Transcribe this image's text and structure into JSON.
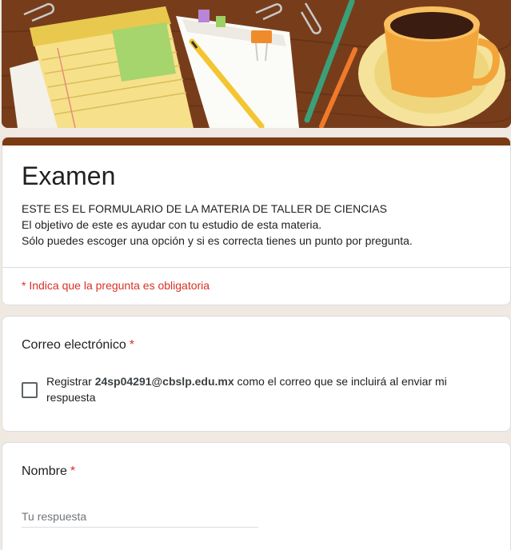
{
  "form": {
    "title": "Examen",
    "description": [
      "ESTE ES EL FORMULARIO DE LA MATERIA DE TALLER DE CIENCIAS",
      "El objetivo de este es ayudar con tu estudio de esta materia.",
      "Sólo puedes escoger una opción y si es correcta tienes un punto por pregunta."
    ],
    "required_note": "* Indica que la pregunta es obligatoria"
  },
  "email_question": {
    "label": "Correo electrónico",
    "required_mark": "*",
    "checkbox_prefix": "Registrar ",
    "email": "24sp04291@cbslp.edu.mx",
    "checkbox_suffix": " como el correo que se incluirá al enviar mi respuesta",
    "checked": false
  },
  "name_question": {
    "label": "Nombre",
    "required_mark": "*",
    "placeholder": "Tu respuesta",
    "value": ""
  },
  "colors": {
    "theme": "#7a3a12",
    "required": "#d93025",
    "background": "#efe9e2"
  },
  "banner": {
    "icon": "desk-illustration-header"
  }
}
